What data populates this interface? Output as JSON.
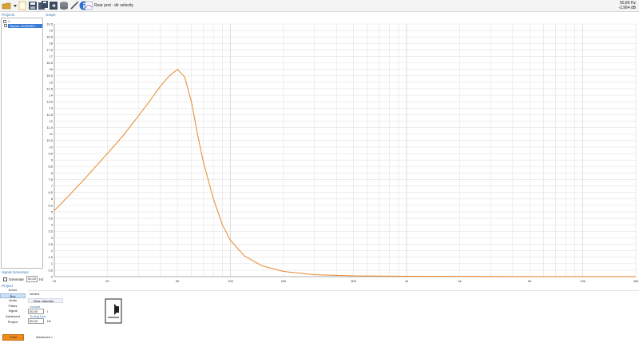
{
  "toolbar": {
    "mode_label": "Rear port - dir velocity",
    "icons": [
      "open-folder-icon",
      "new-project-icon",
      "save-icon",
      "save-all-icon",
      "export-icon",
      "database-icon",
      "measure-probe-icon",
      "info-icon",
      "dropdown-arrow-icon",
      "graph-mode-icon"
    ],
    "readout_freq": "50,89 Hz",
    "readout_db": "-2,964 dB"
  },
  "projects": {
    "title": "Projects",
    "items": [
      {
        "label": "1",
        "selected": false
      },
      {
        "label": "Skyrus 10/100RS - 300",
        "selected": true
      }
    ]
  },
  "graph": {
    "title": "Graph"
  },
  "signal_generator": {
    "title": "Signal Generator",
    "generate_label": "Generate",
    "value": "50,00",
    "unit": "Hz"
  },
  "project_nav": {
    "title": "Project",
    "items": [
      "Driver",
      "Box",
      "Vents",
      "Filters",
      "Signal",
      "Advanced",
      "Project"
    ],
    "selected": "Box",
    "color_button": "Color"
  },
  "box_panel": {
    "box_type": "vented",
    "tab_label": "Rear chamber",
    "volume_label": "Volume",
    "volume_value": "30,00",
    "volume_unit": "l",
    "tuning_label": "Tuning freq.",
    "tuning_value": "50,00",
    "tuning_unit": "Hz",
    "advanced_label": "Advanced >"
  },
  "colors": {
    "curve": "#e8872a",
    "accent": "#3b7bd6",
    "color_button": "#f08a1c"
  },
  "chart_data": {
    "type": "line",
    "x_scale": "log",
    "xlim": [
      10,
      20000
    ],
    "ylim": [
      0,
      19.5
    ],
    "grid": true,
    "x_ticks": [
      {
        "v": 10,
        "label": "10"
      },
      {
        "v": 20,
        "label": "20"
      },
      {
        "v": 50,
        "label": "50"
      },
      {
        "v": 100,
        "label": "100"
      },
      {
        "v": 200,
        "label": "200"
      },
      {
        "v": 500,
        "label": "500"
      },
      {
        "v": 1000,
        "label": "1k"
      },
      {
        "v": 2000,
        "label": "2k"
      },
      {
        "v": 5000,
        "label": "5k"
      },
      {
        "v": 10000,
        "label": "10k"
      },
      {
        "v": 20000,
        "label": "20k"
      }
    ],
    "y_tick_labels": [
      "0",
      "0,5",
      "1",
      "1,5",
      "2",
      "2,5",
      "3",
      "3,5",
      "4",
      "4,5",
      "5",
      "5,5",
      "6",
      "6,5",
      "7",
      "7,5",
      "8",
      "8,5",
      "9",
      "9,5",
      "10",
      "10,5",
      "11",
      "11,5",
      "12",
      "12,5",
      "13",
      "13,5",
      "14",
      "14,5",
      "15",
      "15,5",
      "16",
      "16,5",
      "17",
      "17,5",
      "18",
      "18,5",
      "19",
      "19,5"
    ],
    "series": [
      {
        "x": [
          10,
          12,
          15,
          20,
          25,
          30,
          35,
          40,
          45,
          50,
          55,
          60,
          65,
          70,
          80,
          90,
          100,
          120,
          150,
          200,
          300,
          500,
          1000,
          2000,
          5000,
          10000,
          20000
        ],
        "values": [
          5.1,
          6.2,
          7.6,
          9.5,
          11.0,
          12.4,
          13.6,
          14.7,
          15.5,
          16.0,
          15.4,
          13.5,
          11.0,
          8.9,
          6.0,
          4.0,
          2.8,
          1.6,
          0.85,
          0.4,
          0.15,
          0.06,
          0.03,
          0.02,
          0.01,
          0.01,
          0.01
        ]
      }
    ]
  }
}
